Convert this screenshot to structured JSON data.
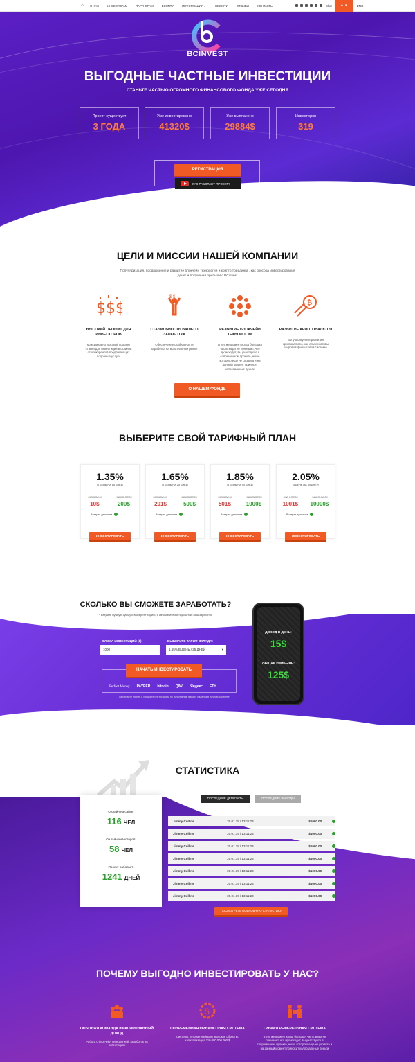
{
  "nav": {
    "items": [
      "О НАС",
      "ИНВЕСТОРАМ",
      "ПАРТНЕРАМ",
      "BOUNTY",
      "ИНФОРМАЦИЯ",
      "НОВОСТИ",
      "ОТЗЫВЫ",
      "КОНТАКТЫ"
    ],
    "chat": "Chat",
    "lang": "ENG"
  },
  "hero": {
    "brand": "BCINVEST",
    "title": "ВЫГОДНЫЕ ЧАСТНЫЕ ИНВЕСТИЦИИ",
    "subtitle": "СТАНЬТЕ ЧАСТЬЮ ОГРОМНОГО ФИНАНСОВОГО ФОНДА УЖЕ СЕГОДНЯ",
    "stats": [
      {
        "label": "Проект существует",
        "value": "3 ГОДА"
      },
      {
        "label": "Уже инвестировано",
        "value": "41320$"
      },
      {
        "label": "Уже выплачено",
        "value": "29884$"
      },
      {
        "label": "Инвесторов",
        "value": "319"
      }
    ],
    "register": "РЕГИСТРАЦИЯ",
    "how": "КАК РАБОТАЕТ ПРОЕКТ?"
  },
  "goals": {
    "title": "ЦЕЛИ И МИССИИ НАШЕЙ КОМПАНИИ",
    "desc": "Популяризация, продвижение и развитие блокчейн технологии и крипто трейдинга , как способа инвестирования денег и получения прибыли с BCinvest",
    "items": [
      {
        "title": "ВЫСОКИЙ ПРОФИТ ДЛЯ ИНВЕСТОРОВ",
        "desc": "Максимально высокий процент ставки для инвестиций в отличии от конкурентов предлагающих подобные услуги"
      },
      {
        "title": "СТАБИЛЬНОСТЬ ВАШЕГО ЗАРАБОТКА",
        "desc": "Обеспечение стабильности заработка на волатильном рынке"
      },
      {
        "title": "РАЗВИТИЕ БЛОКЧЕЙН ТЕХНОЛОГИИ",
        "desc": "В тот же момент когда большая часть мира не понимает, что происходит, вы участвуете в современном проекте, нише которого еще не развита и на данный момент приносит колоссальные деньги"
      },
      {
        "title": "РАЗВИТИЕ КРИПТОВАЛЮТЫ",
        "desc": "Вы участвуете в развитии криптовалюты, как альтернативы мировой финансовой системы"
      }
    ],
    "button": "О НАШЕМ ФОНДЕ"
  },
  "plans": {
    "title": "ВЫБЕРИТЕ СВОЙ ТАРИФНЫЙ ПЛАН",
    "min_label": "МИНИМУМ",
    "max_label": "МАКСИМУМ",
    "deposit_label": "Возврат депозита",
    "button": "ИНВЕСТИРОВАТЬ",
    "items": [
      {
        "pct": "1.35%",
        "period": "В ДЕНЬ НА 15 ДНЕЙ",
        "min": "10$",
        "max": "200$"
      },
      {
        "pct": "1.65%",
        "period": "В ДЕНЬ НА 25 ДНЕЙ",
        "min": "201$",
        "max": "500$"
      },
      {
        "pct": "1.85%",
        "period": "В ДЕНЬ НА 40 ДНЕЙ",
        "min": "501$",
        "max": "1000$"
      },
      {
        "pct": "2.05%",
        "period": "В ДЕНЬ НА 50 ДНЕЙ",
        "min": "1001$",
        "max": "10000$"
      }
    ]
  },
  "calc": {
    "title": "СКОЛЬКО ВЫ СМОЖЕТЕ ЗАРАБОТАТЬ?",
    "hint": "* Введите нужную сумму и выберите тариф, я автоматически подсчитаю ваш заработок",
    "sum_label": "СУММА ИНВЕСТИЦИЙ ($)",
    "sum_value": "1000",
    "plan_label": "ВЫБЕРИТЕ ТАРИФ ВКЛАДА:",
    "plan_value": "1.65% В ДЕНЬ / 25 ДНЕЙ",
    "button": "НАЧАТЬ ИНВЕСТИРОВАТЬ",
    "payments": [
      "Perfect Money",
      "PAYEER",
      "bitcoin",
      "QIWI",
      "Яндекс",
      "ETH"
    ],
    "note": "Выберайте любую и следуйте инструкциям по пополнению вашего баланса в личном кабинете",
    "daily_label": "ДОХОД В ДЕНЬ:",
    "daily_value": "15$",
    "total_label": "ОБЩАЯ ПРИБЫЛЬ:",
    "total_value": "125$"
  },
  "stats": {
    "title": "СТАТИСТИКА",
    "online_label": "Онлайн на сайте:",
    "online_value": "116",
    "online_unit": "ЧЕЛ",
    "investors_label": "Онлайн инвесторов:",
    "investors_value": "58",
    "investors_unit": "ЧЕЛ",
    "work_label": "Проект работает:",
    "work_value": "1241",
    "work_unit": "ДНЕЙ",
    "tab_deposits": "ПОСЛЕДНИЕ ДЕПОЗИТЫ",
    "tab_withdrawals": "ПОСЛЕДНИЕ ВЫВОДЫ",
    "rows": [
      {
        "name": "Jimmy Collins",
        "date": "20.01.19 / 13:11:23",
        "sum": "$1000.00"
      },
      {
        "name": "Jimmy Collins",
        "date": "20.01.19 / 13:11:23",
        "sum": "$1000.00"
      },
      {
        "name": "Jimmy Collins",
        "date": "20.01.19 / 13:11:23",
        "sum": "$1000.00"
      },
      {
        "name": "Jimmy Collins",
        "date": "20.01.19 / 13:11:23",
        "sum": "$1000.00"
      },
      {
        "name": "Jimmy Collins",
        "date": "20.01.19 / 13:11:23",
        "sum": "$1000.00"
      },
      {
        "name": "Jimmy Collins",
        "date": "20.01.19 / 13:11:23",
        "sum": "$1000.00"
      },
      {
        "name": "Jimmy Collins",
        "date": "20.01.19 / 13:11:23",
        "sum": "$1000.00"
      }
    ],
    "button": "ПОСМОТРЕТЬ ПОДРОБНУЮ СТАТИСТИКУ"
  },
  "why": {
    "title": "ПОЧЕМУ ВЫГОДНО ИНВЕСТИРОВАТЬ У НАС?",
    "items": [
      {
        "title": "ОПЫТНАЯ КОМАНДА ФИКСИРОВАННЫЙ ДОХОД",
        "desc": "Работа с блокчейн технологией, заработок на инвестициях"
      },
      {
        "title": "СОВРЕМЕННАЯ ФИНАНСОВАЯ СИСТЕМА",
        "desc": "Система, которая набирает высокие обороты, капитализация 110 000 000 000 $"
      },
      {
        "title": "ГИБКАЯ РЕФЕРАЛЬНАЯ СИСТЕМА",
        "desc": "В тот же момент когда большая часть мира не понимает, что происходит, вы участвуете в современном проекте, ниша которого еще не развита и на данный момент приносит колоссальные деньги"
      }
    ]
  },
  "colors": {
    "accent": "#f15a24",
    "purple": "#5b1fc4",
    "green": "#2ca02c"
  }
}
